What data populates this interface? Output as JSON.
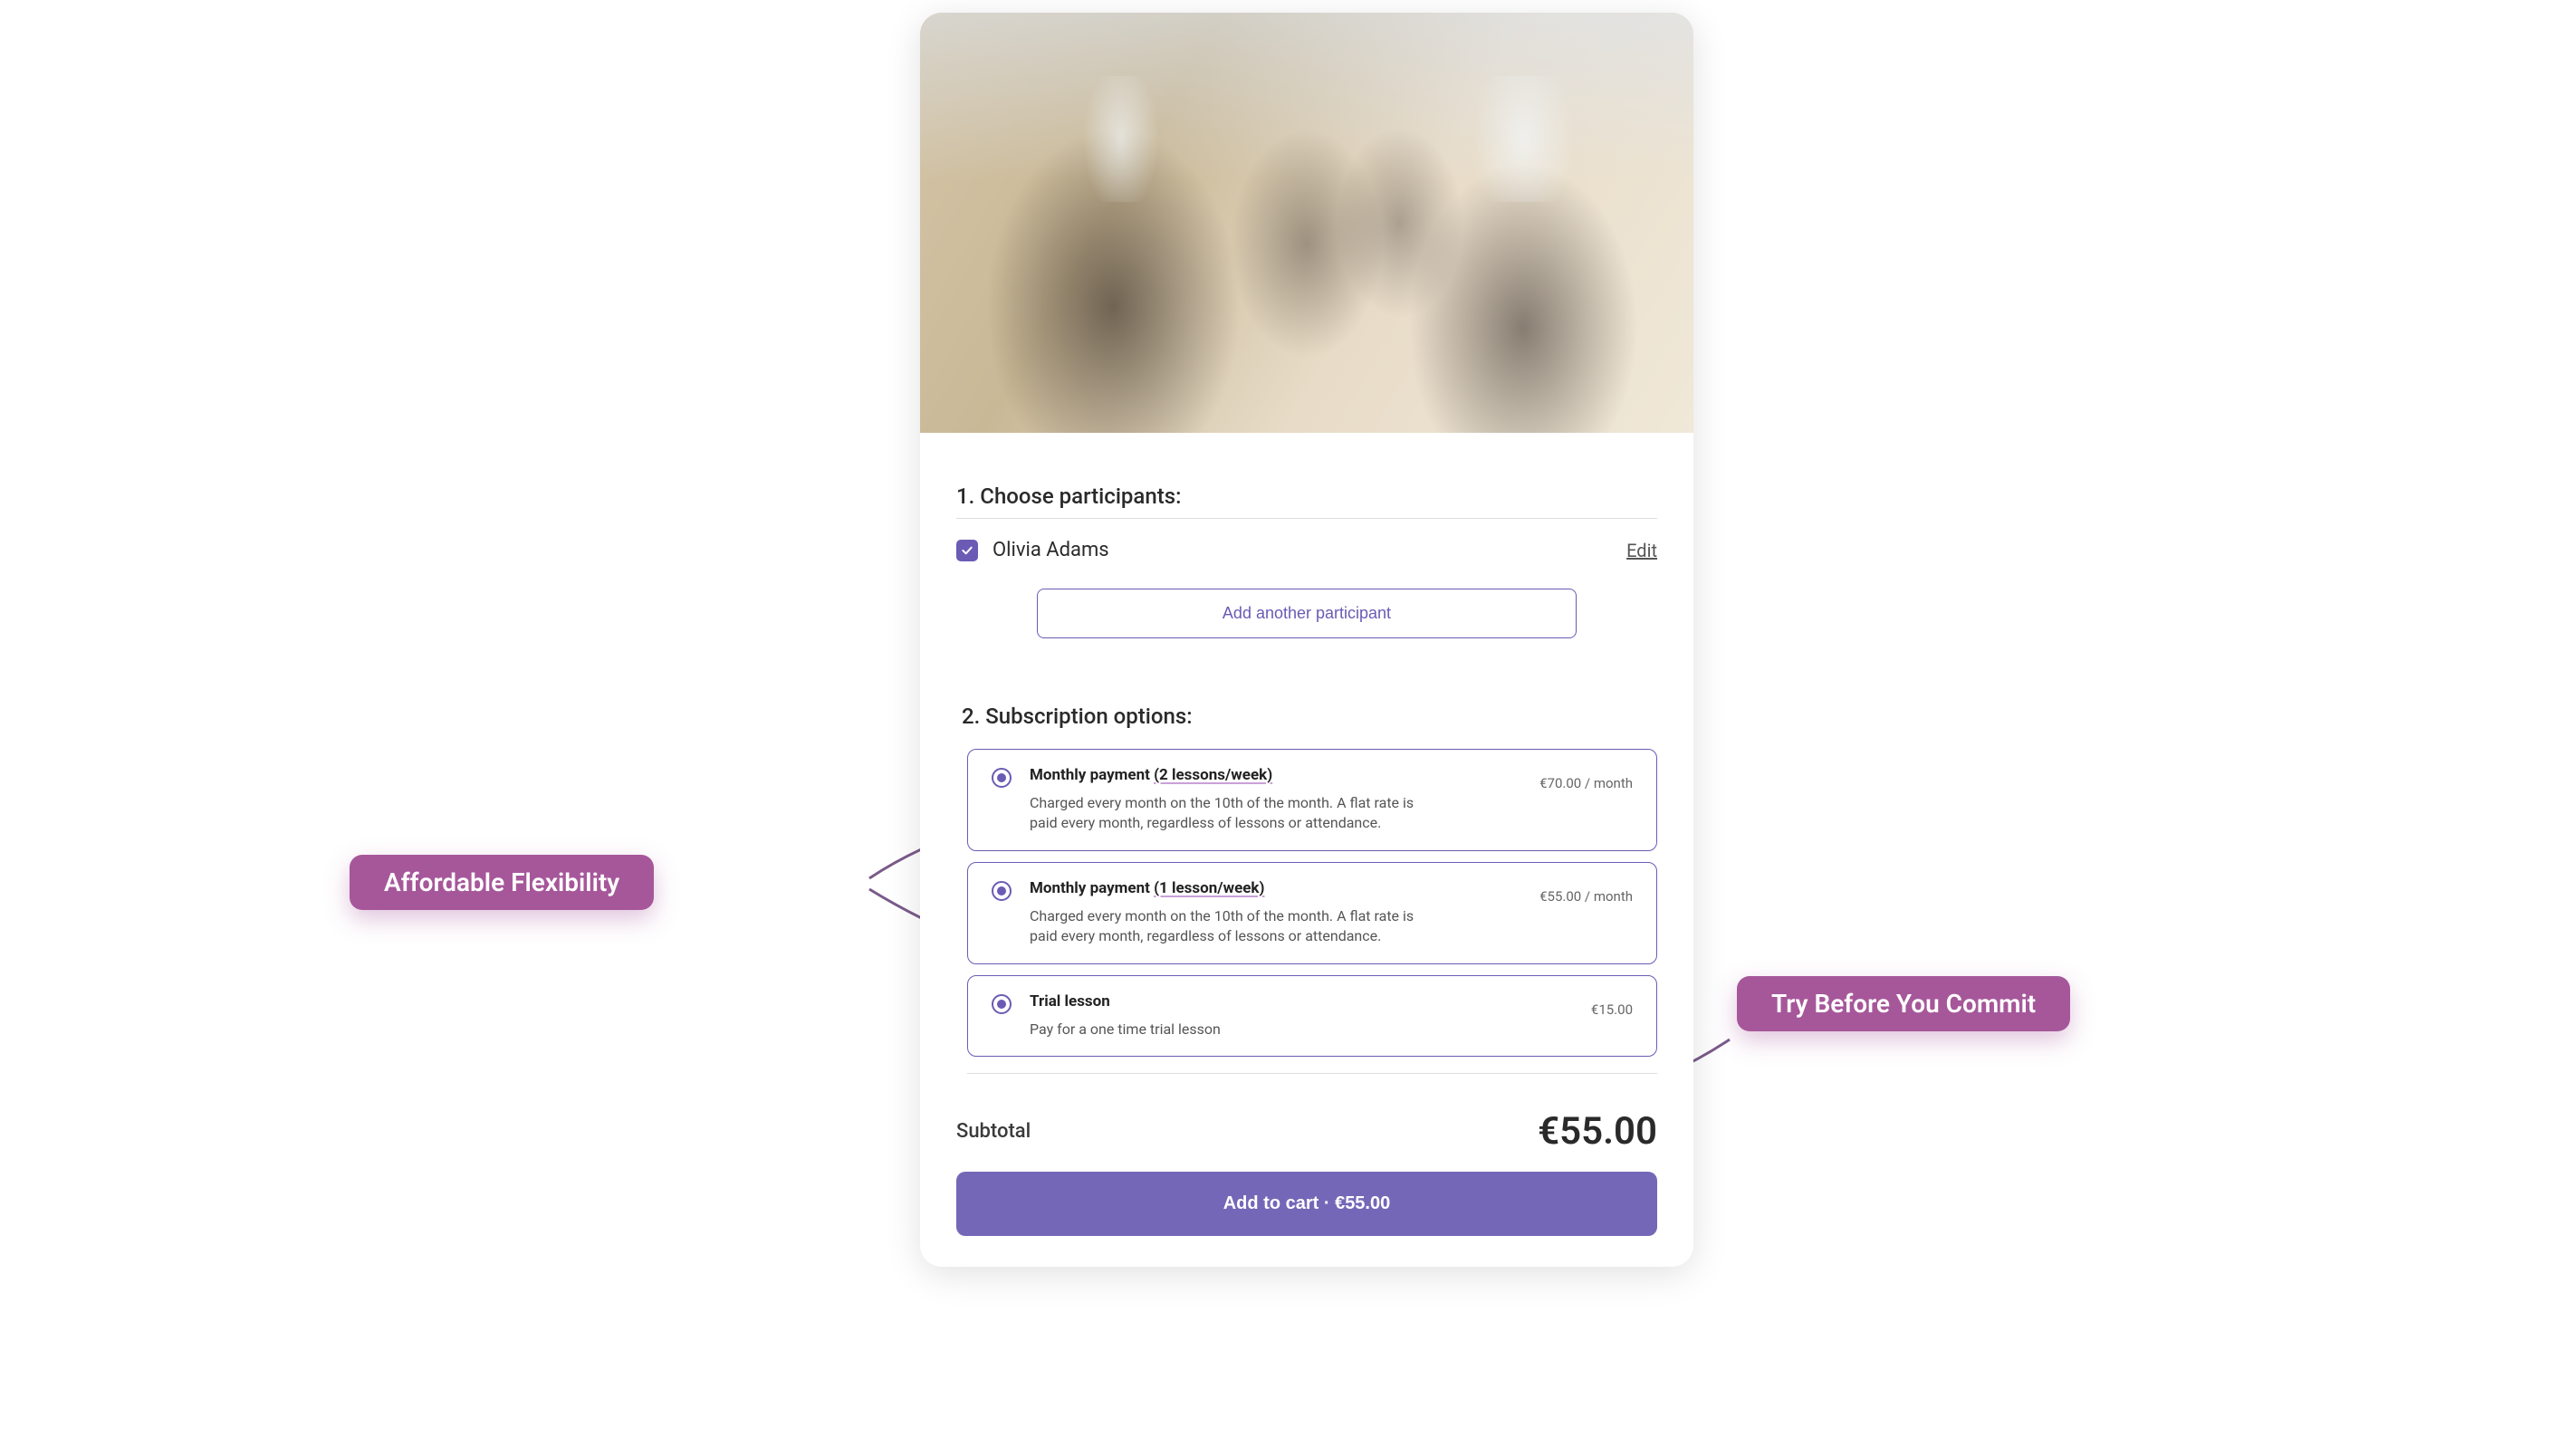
{
  "sections": {
    "choose": {
      "title": "1. Choose participants:"
    },
    "options": {
      "title": "2. Subscription options:"
    }
  },
  "participant": {
    "name": "Olivia Adams",
    "checked": true,
    "edit_label": "Edit"
  },
  "add_participant_label": "Add another participant",
  "plans": [
    {
      "title_prefix": "Monthly payment ",
      "title_highlight": "(2 lessons/week)",
      "desc": "Charged every month on the 10th of the month. A flat rate is paid every month, regardless of lessons or attendance.",
      "price": "€70.00 / month"
    },
    {
      "title_prefix": "Monthly payment ",
      "title_highlight": "(1 lesson/week)",
      "desc": "Charged every month on the 10th of the month. A flat rate is paid every month, regardless of lessons or attendance.",
      "price": "€55.00 / month"
    },
    {
      "title_prefix": "Trial lesson",
      "title_highlight": "",
      "desc": "Pay for a one time trial lesson",
      "price": "€15.00"
    }
  ],
  "subtotal": {
    "label": "Subtotal",
    "amount": "€55.00"
  },
  "add_to_cart_label": "Add to cart · €55.00",
  "callouts": {
    "left": "Affordable Flexibility",
    "right": "Try Before You Commit"
  },
  "colors": {
    "accent": "#6b5bb5",
    "callout": "#a6579a"
  }
}
